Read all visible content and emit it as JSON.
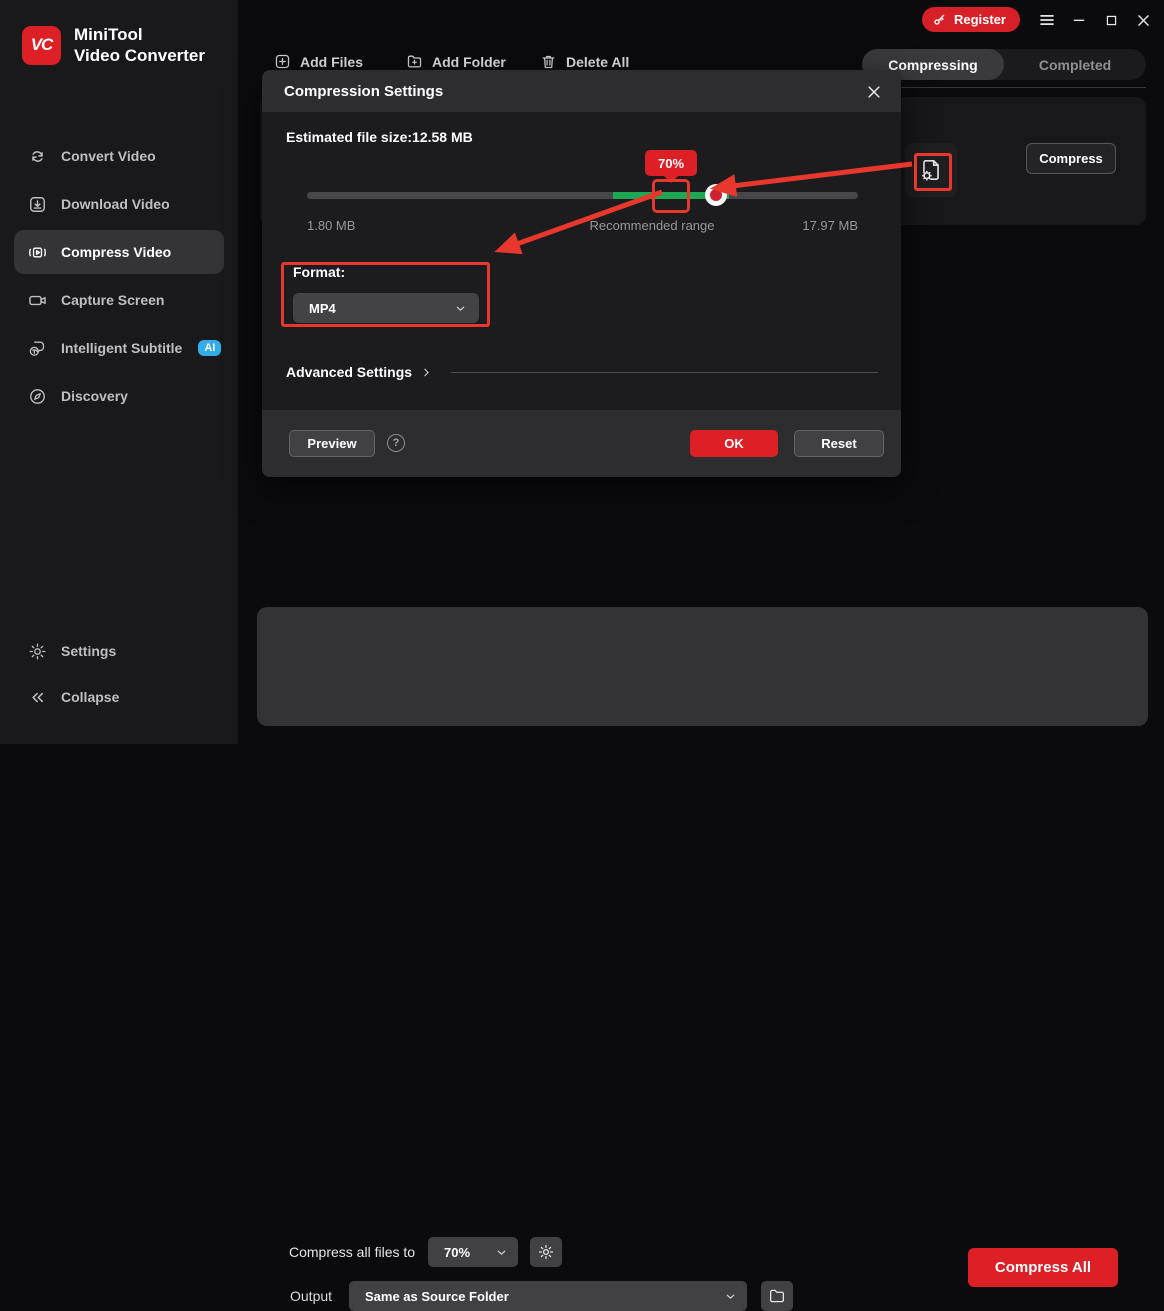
{
  "app": {
    "logo_text": "VC",
    "name_line1": "MiniTool",
    "name_line2": "Video Converter"
  },
  "titlebar": {
    "register_label": "Register"
  },
  "sidebar": {
    "items": [
      {
        "label": "Convert Video"
      },
      {
        "label": "Download Video"
      },
      {
        "label": "Compress Video",
        "active": true
      },
      {
        "label": "Capture Screen"
      },
      {
        "label": "Intelligent Subtitle",
        "badge": "AI"
      },
      {
        "label": "Discovery"
      }
    ],
    "settings_label": "Settings",
    "collapse_label": "Collapse"
  },
  "toolbar": {
    "add_files_label": "Add Files",
    "add_folder_label": "Add Folder",
    "delete_all_label": "Delete All"
  },
  "tabs": {
    "compressing_label": "Compressing",
    "completed_label": "Completed"
  },
  "file_card": {
    "compress_button_label": "Compress"
  },
  "dialog": {
    "title": "Compression Settings",
    "estimated_text": "Estimated file size:12.58 MB",
    "slider": {
      "tooltip_value": "70%",
      "min_label": "1.80 MB",
      "range_label": "Recommended range",
      "max_label": "17.97 MB"
    },
    "format_label": "Format:",
    "format_value": "MP4",
    "advanced_label": "Advanced Settings",
    "preview_button_label": "Preview",
    "help_glyph": "?",
    "ok_button_label": "OK",
    "reset_button_label": "Reset"
  },
  "bottom_bar": {
    "compress_all_label": "Compress all files to",
    "ratio_value": "70%",
    "output_label": "Output",
    "output_value": "Same as Source Folder",
    "compress_all_button_label": "Compress All"
  },
  "colors": {
    "brand_red": "#dd1f26",
    "annotation_red": "#e8372c",
    "recommended_green": "#1ea854",
    "ai_badge_blue": "#31aee9"
  }
}
